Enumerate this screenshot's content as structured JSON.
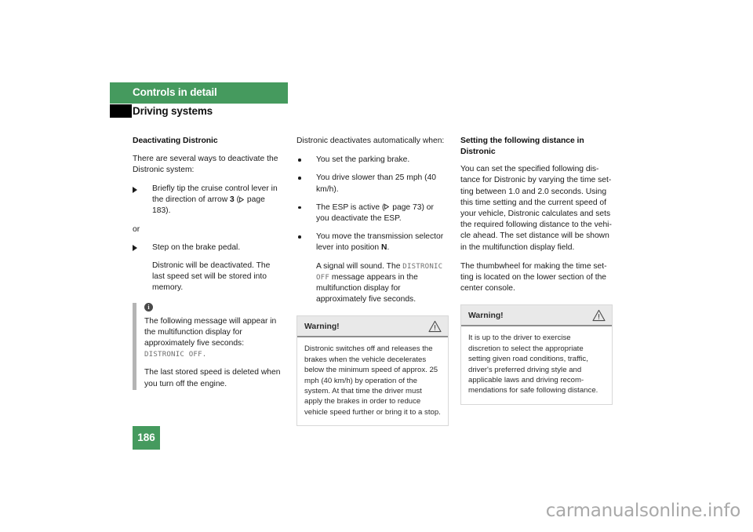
{
  "header": {
    "chapter": "Controls in detail",
    "section": "Driving systems"
  },
  "column_left": {
    "subhead": "Deactivating Distronic",
    "intro": "There are several ways to deactivate the Distronic system:",
    "bullet_1_pre": "Briefly tip the cruise control lever in the direction of arrow ",
    "bullet_1_bold": "3",
    "bullet_1_ref": " page 183).",
    "or_label": "or",
    "bullet_2": "Step on the brake pedal.",
    "bullet_2_sub": "Distronic will be deactivated. The last speed set will be stored into memory.",
    "info": {
      "icon_label": "i",
      "text_1_pre": "The following message will appear in the multifunction display for approximately five seconds: ",
      "text_1_mono": "DISTRONIC OFF.",
      "text_2": "The last stored speed is deleted when you turn off the engine."
    }
  },
  "column_middle": {
    "intro": "Distronic deactivates automatically when:",
    "bullets": [
      "You set the parking brake.",
      "You drive slower than 25 mph (40 km/h).",
      "You move the transmission selector le-ver into position "
    ],
    "bullet_esp_pre": "The ESP is active (",
    "bullet_esp_ref": " page 73) or you deactivate the ESP.",
    "bullet_n_pre": "You move the transmission selector lever into position ",
    "bullet_n_bold": "N",
    "bullet_n_post": ".",
    "bullet_n_sub_pre": "A signal will sound. The ",
    "bullet_n_sub_mono": "DISTRONIC OFF",
    "bullet_n_sub_post": " message appears in the multifunction display for approximately five seconds.",
    "warning": {
      "title": "Warning!",
      "icon": "warning-triangle",
      "body": "Distronic switches off and releases the brakes when the vehicle decelerates below the minimum speed of approx. 25 mph (40 km/h) by operation of the system. At that time the driver must apply the brakes in order to reduce vehicle speed further or bring it to a stop."
    }
  },
  "column_right": {
    "subhead": "Setting the following distance in Distronic",
    "para_1": "You can set the specified following dis-tance for Distronic by varying the time set-ting between 1.0 and 2.0 seconds. Using this time setting and the current speed of your vehicle, Distronic calculates and sets the required following distance to the vehi-cle ahead. The set distance will be shown in the multifunction display field.",
    "para_2": "The thumbwheel for making the time set-ting is located on the lower section of the center console.",
    "warning": {
      "title": "Warning!",
      "icon": "warning-triangle",
      "body": "It is up to the driver to exercise discretion to select the appropriate setting given road conditions, traffic, driver's preferred driving style and applicable laws and driving recom-mendations for safe following distance."
    }
  },
  "footer": {
    "page_number": "186",
    "watermark": "carmanualsonline.info"
  },
  "colors": {
    "brand_green": "#459a5e",
    "warning_header_bg": "#e9e9e9",
    "info_rule": "#b4b4b4",
    "watermark": "#a9a9a9"
  }
}
